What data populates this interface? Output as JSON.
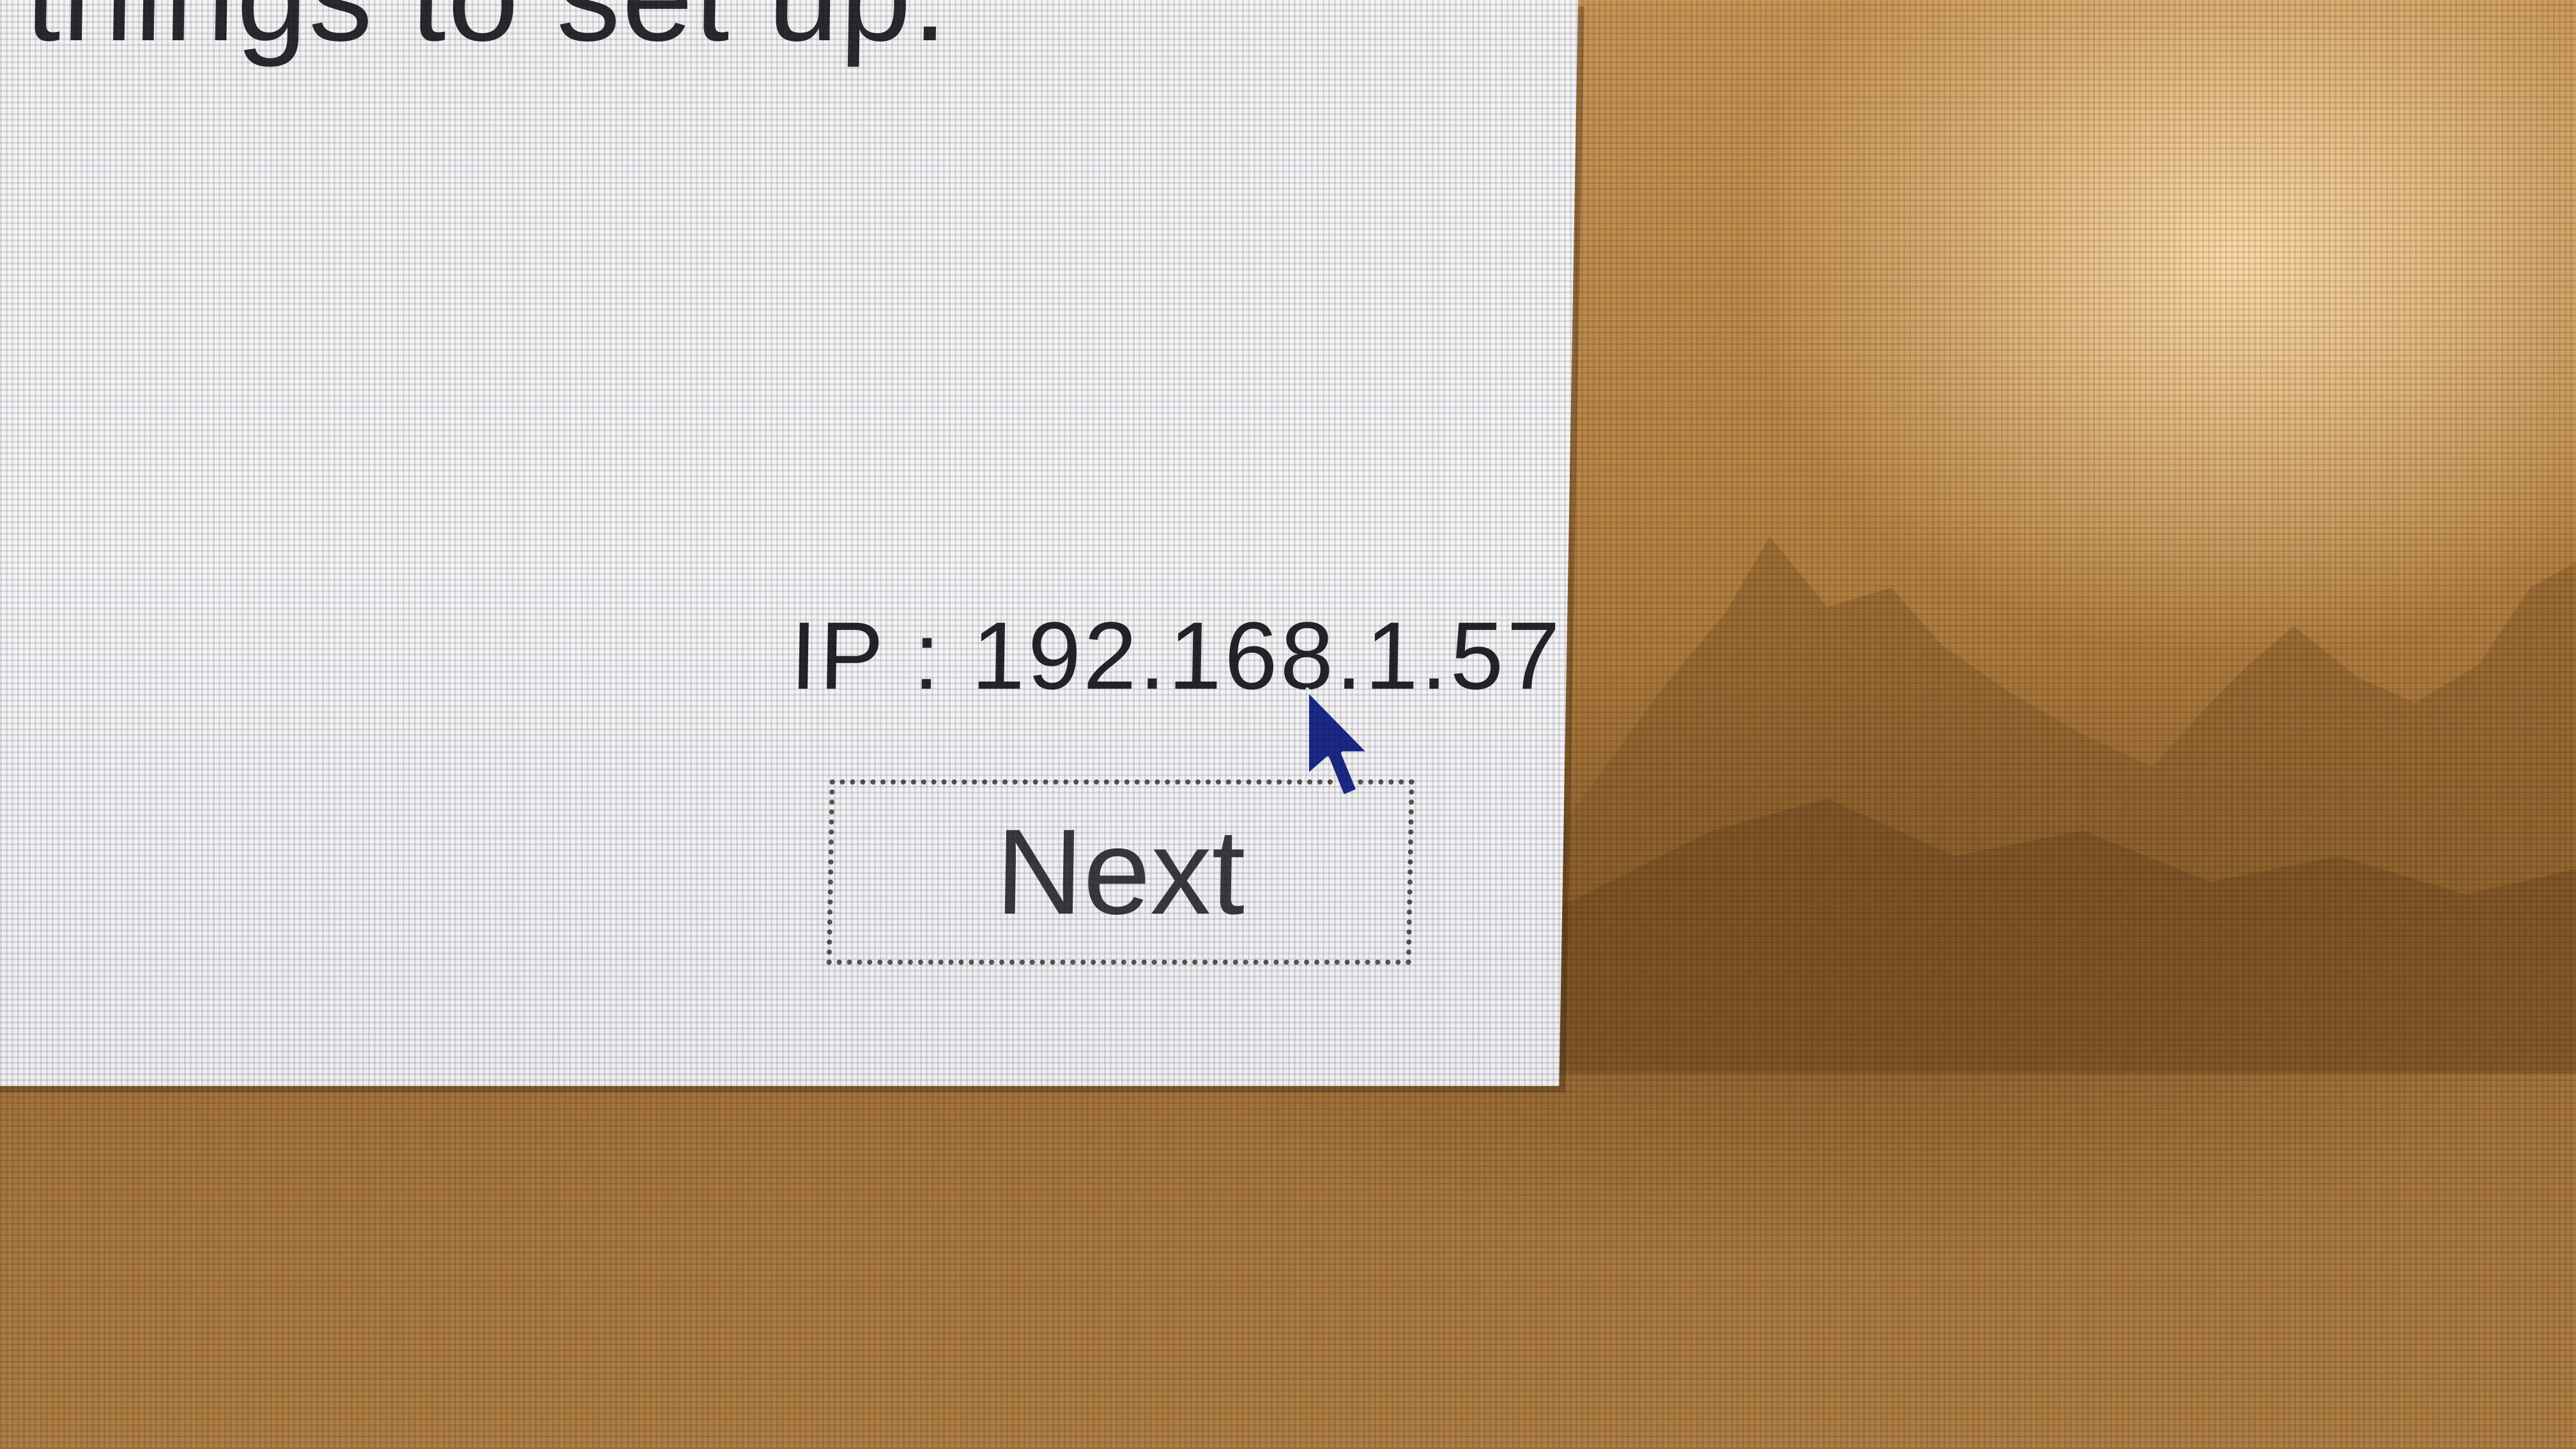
{
  "dialog": {
    "intro_text": "things to set up.",
    "ip_text": "IP : 192.168.1.57",
    "next_label": "Next"
  },
  "icons": {
    "cursor": "mouse-pointer-arrow-icon"
  },
  "colors": {
    "dialog_background": "#f4f3f6",
    "desktop_wallpaper": "#b98445",
    "cursor": "#1b2a8a"
  }
}
